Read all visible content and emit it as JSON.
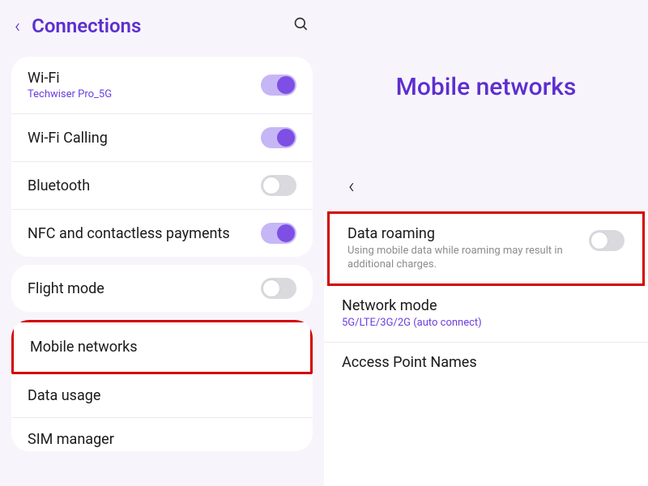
{
  "colors": {
    "accent": "#5e2ecf",
    "highlight": "#d30000"
  },
  "left": {
    "title": "Connections",
    "group1": [
      {
        "title": "Wi-Fi",
        "sub": "Techwiser Pro_5G",
        "subStyle": "accent",
        "toggle": "on"
      },
      {
        "title": "Wi-Fi Calling",
        "toggle": "on"
      },
      {
        "title": "Bluetooth",
        "toggle": "off"
      },
      {
        "title": "NFC and contactless payments",
        "toggle": "on"
      }
    ],
    "group2_first": {
      "title": "Flight mode",
      "toggle": "off"
    },
    "group3": [
      {
        "title": "Mobile networks",
        "highlight": true
      },
      {
        "title": "Data usage"
      },
      {
        "title": "SIM manager"
      }
    ]
  },
  "right": {
    "title": "Mobile networks",
    "rows": [
      {
        "title": "Data roaming",
        "sub": "Using mobile data while roaming may result in additional charges.",
        "toggle": "off",
        "highlight": true
      },
      {
        "title": "Network mode",
        "sub": "5G/LTE/3G/2G (auto connect)",
        "subStyle": "accent"
      },
      {
        "title": "Access Point Names"
      }
    ]
  }
}
